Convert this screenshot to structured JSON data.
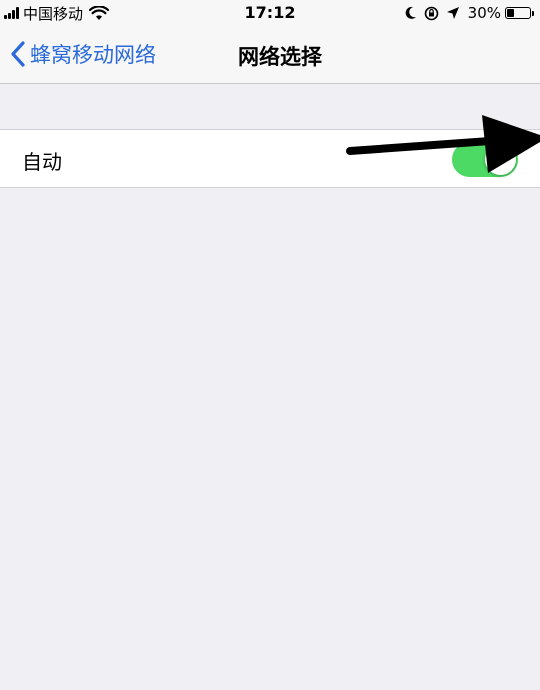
{
  "status_bar": {
    "carrier": "中国移动",
    "time": "17:12",
    "battery_percent": "30%",
    "battery_level": 0.3,
    "icons": [
      "signal-icon",
      "wifi-icon",
      "moon-icon",
      "rotation-lock-icon",
      "location-icon",
      "battery-icon"
    ]
  },
  "nav": {
    "back_label": "蜂窝移动网络",
    "title": "网络选择"
  },
  "settings": {
    "automatic_label": "自动",
    "automatic_on": true
  },
  "colors": {
    "accent": "#2a6ad9",
    "toggle_on": "#4cd964",
    "background": "#efeff4"
  }
}
